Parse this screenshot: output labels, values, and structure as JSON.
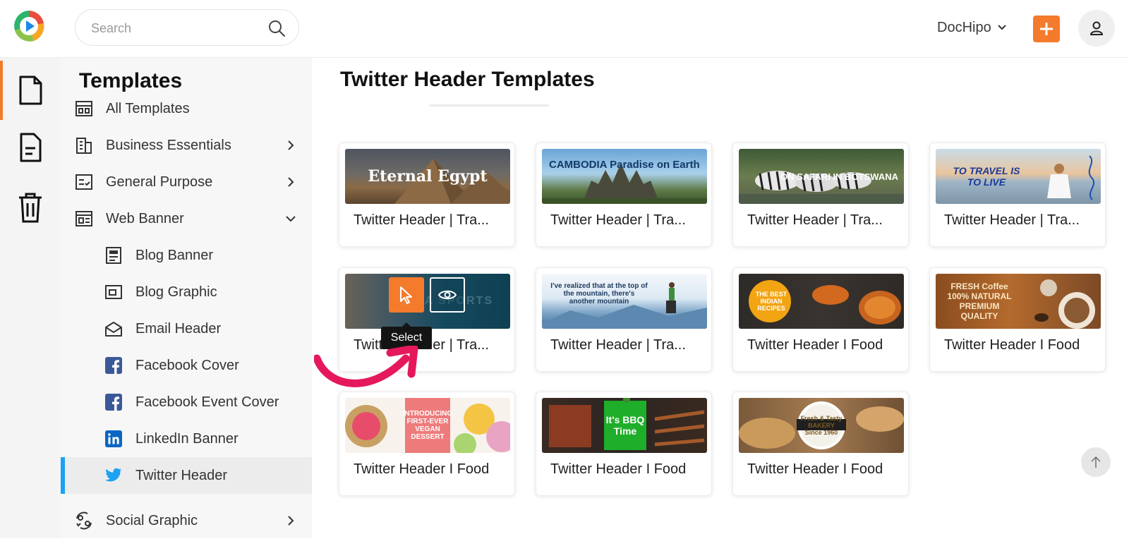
{
  "header": {
    "search_placeholder": "Search",
    "account_name": "DocHipo"
  },
  "sidebar": {
    "title": "Templates",
    "items": [
      {
        "label": "All Templates"
      },
      {
        "label": "Business Essentials"
      },
      {
        "label": "General Purpose"
      },
      {
        "label": "Web Banner"
      },
      {
        "label": "Blog Banner"
      },
      {
        "label": "Blog Graphic"
      },
      {
        "label": "Email Header"
      },
      {
        "label": "Facebook Cover"
      },
      {
        "label": "Facebook Event Cover"
      },
      {
        "label": "LinkedIn Banner"
      },
      {
        "label": "Twitter Header"
      },
      {
        "label": "Social Graphic"
      }
    ]
  },
  "main": {
    "title": "Twitter Header Templates",
    "cards": [
      {
        "label": "Twitter Header | Tra...",
        "thumb_text": "Eternal Egypt"
      },
      {
        "label": "Twitter Header | Tra...",
        "thumb_text": "CAMBODIA  Paradise on Earth"
      },
      {
        "label": "Twitter Header | Tra...",
        "thumb_text": "ON SAFARI IN BOTSWANA"
      },
      {
        "label": "Twitter Header | Tra...",
        "thumb_text": "TO TRAVEL IS TO LIVE"
      },
      {
        "label": "Twitter Header | Tra...",
        "thumb_text": "NOVA SPORTS"
      },
      {
        "label": "Twitter Header | Tra...",
        "thumb_text": "I've realized that at the top of the mountain, there's another mountain"
      },
      {
        "label": "Twitter Header I Food",
        "thumb_text": "THE BEST INDIAN RECIPES"
      },
      {
        "label": "Twitter Header I Food",
        "thumb_text": "FRESH Coffee 100% NATURAL PREMIUM QUALITY"
      },
      {
        "label": "Twitter Header I Food",
        "thumb_text": "INTRODUCING FIRST-EVER VEGAN DESSERT"
      },
      {
        "label": "Twitter Header I Food",
        "thumb_text": "It's BBQ Time"
      },
      {
        "label": "Twitter Header I Food",
        "thumb_text": "Fresh & Tasty BAKERY Since 1960"
      }
    ],
    "hover_tooltip": "Select"
  },
  "colors": {
    "accent": "#f47a2c",
    "twitter_blue": "#1da1f2",
    "annotation": "#e5185c"
  }
}
